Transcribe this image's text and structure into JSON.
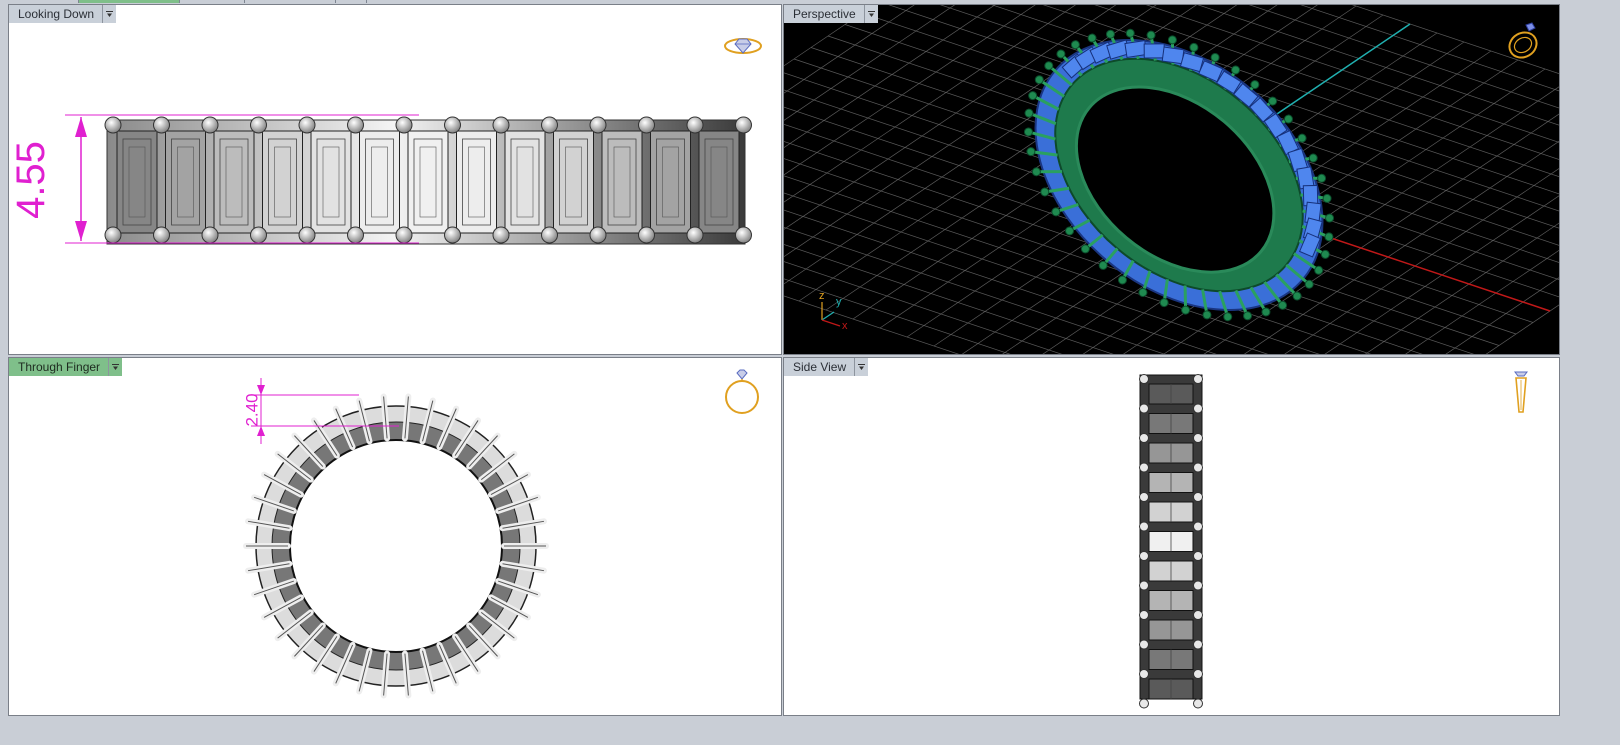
{
  "viewports": {
    "top": {
      "label": "Looking Down",
      "dimension": "4.55"
    },
    "perspective": {
      "label": "Perspective",
      "axes": {
        "z": "z",
        "y": "y",
        "x": "x"
      }
    },
    "front": {
      "label": "Through Finger",
      "dimension": "2.40"
    },
    "side": {
      "label": "Side View"
    }
  },
  "icons": {
    "menu": "dropdown-arrow-icon",
    "top_view": "ring-top-view-icon",
    "perspective_view": "ring-perspective-icon",
    "front_view": "ring-front-view-icon",
    "side_view": "ring-side-view-icon"
  },
  "colors": {
    "dimension": "#e020d0",
    "active_label": "#7fbf8a",
    "inactive_label": "#c9d0d9",
    "gem_blue": "#3a6fd8",
    "metal_green": "#1e7a4c",
    "axis_red": "#c01818",
    "axis_cyan": "#20b0b0",
    "icon_gold": "#e0a020"
  }
}
